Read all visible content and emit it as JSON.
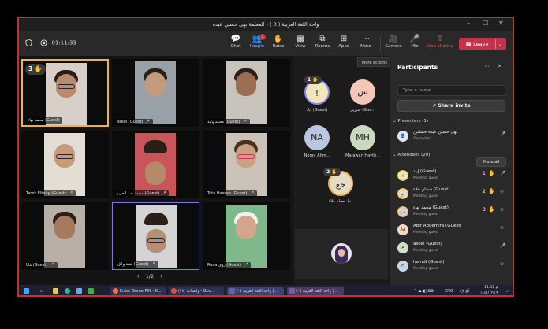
{
  "window": {
    "title": "واحة اللغة العربية ( 3 ) - المعلمة نهى حسين عبده",
    "controls": [
      "–",
      "☐",
      "✕"
    ]
  },
  "toolbar": {
    "timer": "01:11:33",
    "buttons": [
      {
        "label": "Chat",
        "icon": "chat-icon",
        "glyph": "💬"
      },
      {
        "label": "People",
        "icon": "people-icon",
        "glyph": "👥",
        "badge": "3"
      },
      {
        "label": "Raise",
        "icon": "raise-hand-icon",
        "glyph": "✋"
      },
      {
        "label": "View",
        "icon": "view-icon",
        "glyph": "▦"
      },
      {
        "label": "Rooms",
        "icon": "rooms-icon",
        "glyph": "⧉"
      },
      {
        "label": "Apps",
        "icon": "apps-icon",
        "glyph": "⊞"
      },
      {
        "label": "More",
        "icon": "more-icon",
        "glyph": "⋯"
      },
      {
        "label": "Camera",
        "icon": "camera-icon",
        "glyph": "🎥"
      },
      {
        "label": "Mic",
        "icon": "mic-icon",
        "glyph": "🎤"
      },
      {
        "label": "Stop sharing",
        "icon": "share-icon",
        "glyph": "⇪"
      }
    ],
    "leave_label": "Leave",
    "more_actions_tip": "More actions"
  },
  "grid": {
    "tiles": [
      {
        "name": "محمد بهاء (Guest)",
        "hand_count": "3"
      },
      {
        "name": "aseel (Guest)"
      },
      {
        "name": "محمد وليد (Guest)"
      },
      {
        "name": "Tarek Eltaity (Guest)"
      },
      {
        "name": "محمد عبد العزيز (Guest)"
      },
      {
        "name": "Tota Hassan (Guest)"
      },
      {
        "name": "مايا (Guest)"
      },
      {
        "name": "بثنية وائل (Guest)"
      },
      {
        "name": "Roaa رؤى (Guest)"
      }
    ],
    "pager": "1/2"
  },
  "middle": {
    "avatars": [
      {
        "initials": "!",
        "name": "إياد (Guest)",
        "hand": "1",
        "color": "#f0e6b8"
      },
      {
        "initials": "س",
        "name": "سيرين (Gue...",
        "color": "#f4c6b8"
      },
      {
        "initials": "NA",
        "name": "Noray Ahm...",
        "color": "#b9c8e0"
      },
      {
        "initials": "MH",
        "name": "Marawan Hayth...",
        "color": "#c8d9c0"
      },
      {
        "initials": "حع",
        "name": "حسام علاء (...",
        "hand": "2",
        "color": "#e6dcc4"
      }
    ]
  },
  "panel": {
    "title": "Participants",
    "search_placeholder": "Type a name",
    "share_invite": "Share invite",
    "presenters_label": "Presenters (1)",
    "attendees_label": "Attendees (20)",
    "mute_all": "Mute all",
    "presenter": {
      "name": "نهى حسين عبده حسانين",
      "role": "Organizer"
    },
    "attendees": [
      {
        "name": "إياد (Guest)",
        "role": "Meeting guest",
        "initials": "!",
        "hand": "1",
        "mic": "on"
      },
      {
        "name": "حسام علاء (Guest)",
        "role": "Meeting guest",
        "initials": "حع",
        "hand": "2",
        "mic": "off"
      },
      {
        "name": "محمد بهاء (Guest)",
        "role": "Meeting guest",
        "initials": "مب",
        "hand": "3",
        "mic": "off"
      },
      {
        "name": "Abir Aboemira (Guest)",
        "role": "Meeting guest",
        "initials": "AA",
        "mic": "off"
      },
      {
        "name": "aseel (Guest)",
        "role": "Meeting guest",
        "initials": "A",
        "mic": "on"
      },
      {
        "name": "hamdi (Guest)",
        "role": "Meeting guest",
        "initials": "H",
        "mic": "off"
      }
    ]
  },
  "taskbar": {
    "items": [
      {
        "label": "Enter Game PIN - K...",
        "icon": "firefox-icon"
      },
      {
        "label": "واتساب (٣٧) - Goo...",
        "icon": "chrome-icon"
      },
      {
        "label": "واحة اللغة العربية ( ٣ | ...",
        "icon": "teams-icon"
      },
      {
        "label": "واحة اللغة العربية ( ٣ | ...",
        "icon": "teams-icon"
      }
    ],
    "lang": "ENG",
    "time": "11:52 م",
    "date": "١٤٤٤/٠٣/١٩"
  }
}
